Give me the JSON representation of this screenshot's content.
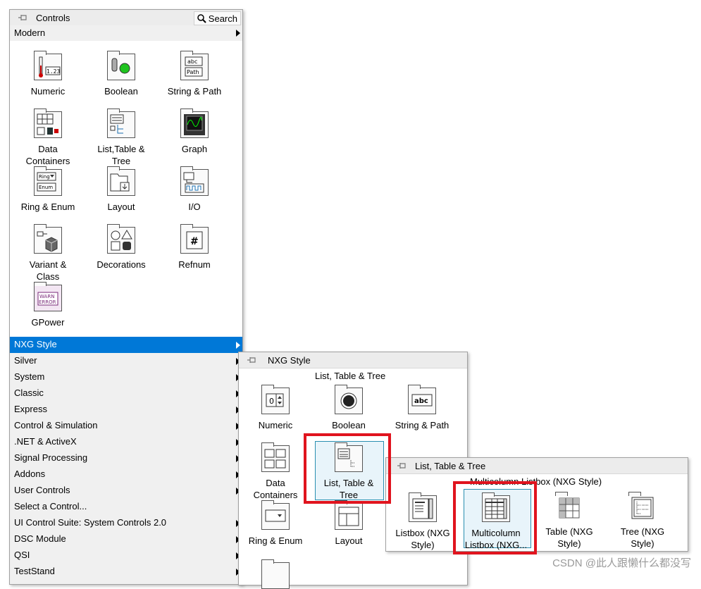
{
  "controls_palette": {
    "title": "Controls",
    "search_label": "Search",
    "category": "Modern",
    "tiles": [
      {
        "label": "Numeric",
        "icon": "numeric-icon"
      },
      {
        "label": "Boolean",
        "icon": "boolean-icon"
      },
      {
        "label": "String & Path",
        "icon": "string-path-icon"
      },
      {
        "label": "Data\nContainers",
        "icon": "data-containers-icon"
      },
      {
        "label": "List,Table &\nTree",
        "icon": "list-table-tree-icon"
      },
      {
        "label": "Graph",
        "icon": "graph-icon"
      },
      {
        "label": "Ring & Enum",
        "icon": "ring-enum-icon"
      },
      {
        "label": "Layout",
        "icon": "layout-icon"
      },
      {
        "label": "I/O",
        "icon": "io-icon"
      },
      {
        "label": "Variant &\nClass",
        "icon": "variant-class-icon"
      },
      {
        "label": "Decorations",
        "icon": "decorations-icon"
      },
      {
        "label": "Refnum",
        "icon": "refnum-icon"
      },
      {
        "label": "GPower",
        "icon": "gpower-icon"
      }
    ],
    "menu_items": [
      {
        "label": "NXG Style",
        "selected": true
      },
      {
        "label": "Silver"
      },
      {
        "label": "System"
      },
      {
        "label": "Classic"
      },
      {
        "label": "Express"
      },
      {
        "label": "Control & Simulation"
      },
      {
        "label": ".NET & ActiveX"
      },
      {
        "label": "Signal Processing"
      },
      {
        "label": "Addons"
      },
      {
        "label": "User Controls"
      },
      {
        "label": "Select a Control..."
      },
      {
        "label": "UI Control Suite: System Controls 2.0"
      },
      {
        "label": "DSC Module"
      },
      {
        "label": "QSI"
      },
      {
        "label": "TestStand"
      }
    ]
  },
  "nxg_palette": {
    "title": "NXG Style",
    "subheading": "List, Table & Tree",
    "tiles": [
      {
        "label": "Numeric",
        "icon": "nxg-numeric-icon"
      },
      {
        "label": "Boolean",
        "icon": "nxg-boolean-icon"
      },
      {
        "label": "String & Path",
        "icon": "nxg-string-path-icon"
      },
      {
        "label": "Data\nContainers",
        "icon": "nxg-data-containers-icon"
      },
      {
        "label": "List, Table &\nTree",
        "icon": "nxg-list-table-tree-icon"
      },
      {
        "label": "Ring & Enum",
        "icon": "nxg-ring-enum-icon"
      },
      {
        "label": "Layout",
        "icon": "nxg-layout-icon"
      }
    ]
  },
  "ltt_palette": {
    "title": "List, Table & Tree",
    "subheading": "Multicolumn Listbox (NXG Style)",
    "tiles": [
      {
        "label": "Listbox (NXG\nStyle)",
        "icon": "listbox-icon"
      },
      {
        "label": "Multicolumn\nListbox (NXG...",
        "icon": "multicolumn-listbox-icon"
      },
      {
        "label": "Table (NXG\nStyle)",
        "icon": "table-icon"
      },
      {
        "label": "Tree (NXG\nStyle)",
        "icon": "tree-icon"
      }
    ]
  },
  "watermark": "CSDN @此人跟懒什么都没写",
  "colors": {
    "selection": "#0078d7",
    "highlight": "#e0141e"
  }
}
